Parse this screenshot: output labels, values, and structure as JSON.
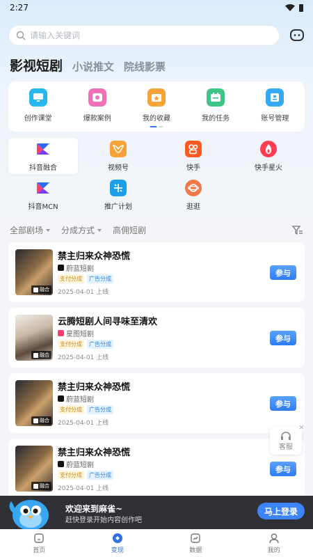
{
  "status_bar": {
    "time": "2:27"
  },
  "search": {
    "placeholder": "请输入关键词"
  },
  "tabs": [
    {
      "label": "影视短剧",
      "active": true
    },
    {
      "label": "小说推文",
      "active": false
    },
    {
      "label": "院线影票",
      "active": false
    }
  ],
  "features": [
    {
      "label": "创作课堂",
      "icon": "monitor-icon",
      "color": "#29b6ee"
    },
    {
      "label": "爆款案例",
      "icon": "photo-icon",
      "color": "#f06fb9"
    },
    {
      "label": "我的收藏",
      "icon": "folder-star-icon",
      "color": "#f6a33a"
    },
    {
      "label": "我的任务",
      "icon": "calendar-icon",
      "color": "#3ec487"
    },
    {
      "label": "账号管理",
      "icon": "id-card-icon",
      "color": "#36a9f3"
    }
  ],
  "platforms": [
    {
      "label": "抖音融合",
      "icon": "douyin-fusion-icon",
      "selected": true
    },
    {
      "label": "视频号",
      "icon": "channels-icon",
      "selected": false
    },
    {
      "label": "快手",
      "icon": "kuaishou-icon",
      "selected": false
    },
    {
      "label": "快手星火",
      "icon": "kuaishou-spark-icon",
      "selected": false
    },
    {
      "label": "抖音MCN",
      "icon": "douyin-mcn-icon",
      "selected": false
    },
    {
      "label": "推广计划",
      "icon": "promotion-plan-icon",
      "selected": false
    },
    {
      "label": "逛逛",
      "icon": "browse-icon",
      "selected": false
    }
  ],
  "filters": {
    "theater": "全部剧场",
    "split_mode": "分成方式",
    "high_commission": "高佣短剧"
  },
  "dramas": [
    {
      "title": "禁主归来众神恐慌",
      "producer": "蔚蓝短剧",
      "badges": [
        "支付分成",
        "广告分成"
      ],
      "date": "2025-04-01 上线",
      "poster_tag": "融合",
      "join_label": "参与"
    },
    {
      "title": "云腾短剧人间寻味至清欢",
      "producer": "星图短剧",
      "badges": [
        "支付分成",
        "广告分成"
      ],
      "date": "2025-04-01 上线",
      "poster_tag": "融合",
      "join_label": "参与"
    },
    {
      "title": "禁主归来众神恐慌",
      "producer": "蔚蓝短剧",
      "badges": [
        "支付分成",
        "广告分成"
      ],
      "date": "2025-04-01 上线",
      "poster_tag": "融合",
      "join_label": "参与"
    },
    {
      "title": "禁主归来众神恐慌",
      "producer": "蔚蓝短剧",
      "badges": [
        "支付分成",
        "广告分成"
      ],
      "date": "2025-04-01 上线",
      "poster_tag": "融合",
      "join_label": "参与"
    }
  ],
  "service": {
    "label": "客服",
    "close": "×"
  },
  "login_banner": {
    "title": "欢迎来到麻雀~",
    "subtitle": "赶快登录开始内容创作吧",
    "button": "马上登录"
  },
  "bottom_nav": [
    {
      "label": "首页",
      "icon": "home-icon",
      "active": false
    },
    {
      "label": "变现",
      "icon": "monetize-icon",
      "active": true
    },
    {
      "label": "数据",
      "icon": "chart-icon",
      "active": false
    },
    {
      "label": "我的",
      "icon": "profile-icon",
      "active": false
    }
  ],
  "colors": {
    "accent": "#3d84f7",
    "pay_badge": "#c88a1a",
    "ad_badge": "#2f86e0"
  }
}
